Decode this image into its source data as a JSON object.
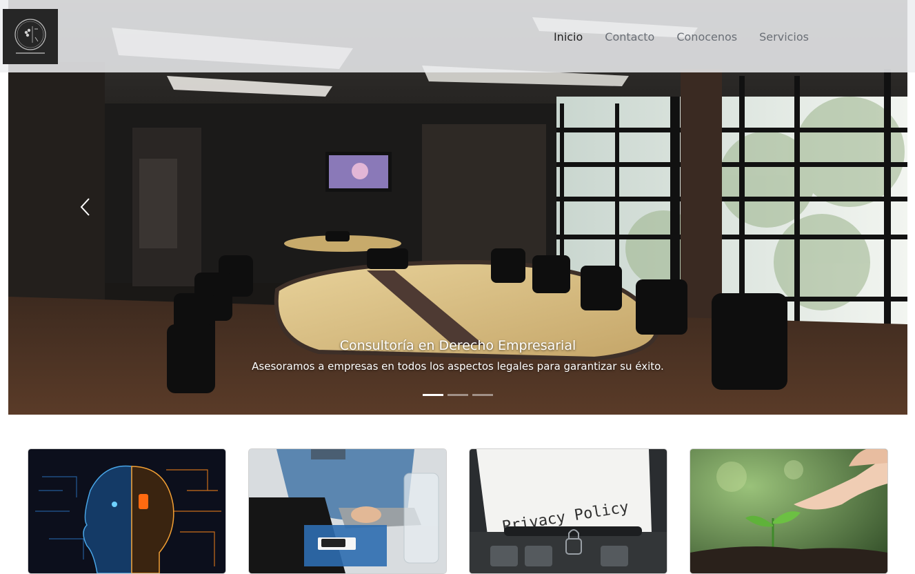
{
  "navbar": {
    "links": [
      {
        "label": "Inicio",
        "active": true
      },
      {
        "label": "Contacto",
        "active": false
      },
      {
        "label": "Conocenos",
        "active": false
      },
      {
        "label": "Servicios",
        "active": false
      }
    ]
  },
  "carousel": {
    "caption_title": "Consultoría en Derecho Empresarial",
    "caption_text": "Asesoramos a empresas en todos los aspectos legales para garantizar su éxito.",
    "slide_count": 3,
    "active_slide": 1
  },
  "cards": [
    {
      "image": "ai-brain-circuit-image"
    },
    {
      "image": "person-laptop-image"
    },
    {
      "image": "privacy-policy-typewriter-image",
      "text": "Privacy Policy"
    },
    {
      "image": "hand-watering-plant-image"
    }
  ],
  "colors": {
    "navbar_bg": "#ecedf0",
    "nav_text": "#6a6f76",
    "nav_active": "#222222"
  }
}
